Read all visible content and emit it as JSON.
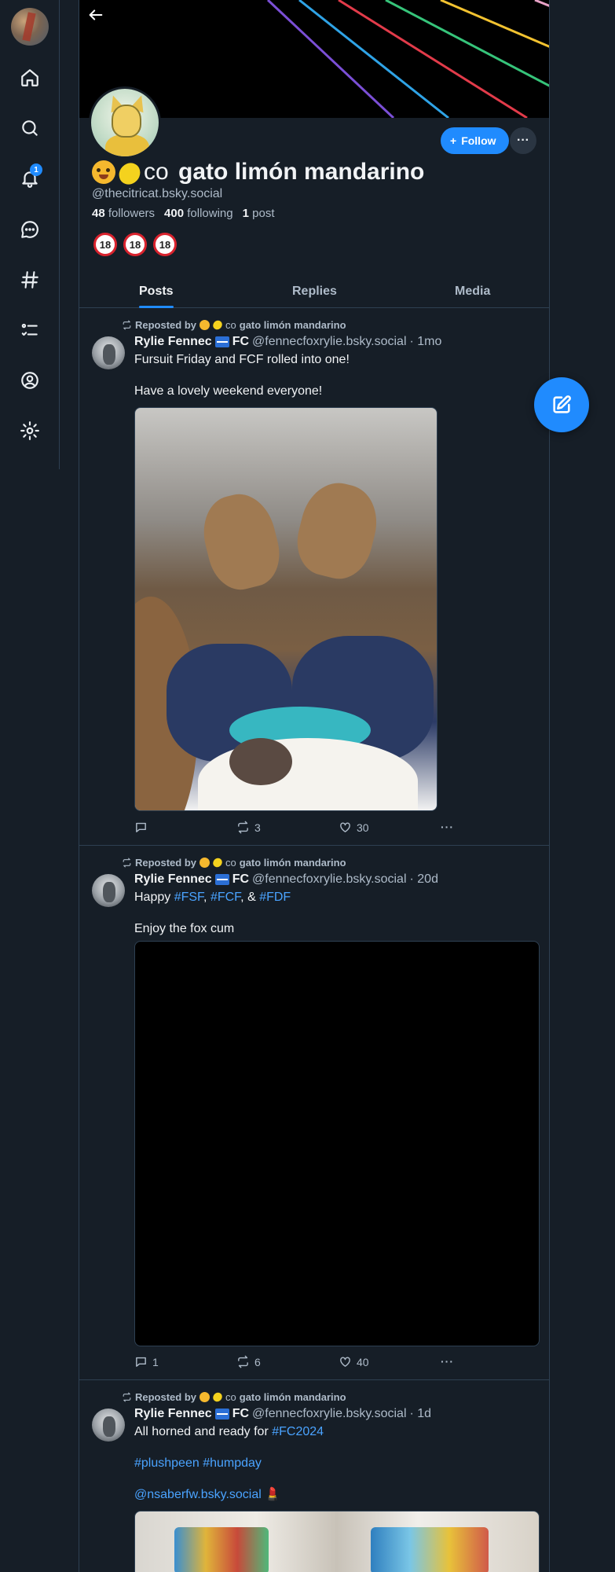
{
  "profile": {
    "name_prefix": "co",
    "name_main": "gato limón mandarino",
    "handle": "@thecitricat.bsky.social",
    "followers_count": "48",
    "followers_label": "followers",
    "following_count": "400",
    "following_label": "following",
    "posts_count": "1",
    "posts_label": "post",
    "content_labels": [
      "18",
      "18",
      "18"
    ],
    "follow_label": "Follow",
    "more_label": "···"
  },
  "nav": {
    "notification_count": "1",
    "items": [
      "home-icon",
      "search-icon",
      "bell-icon",
      "chat-icon",
      "hashtag-icon",
      "list-icon",
      "profile-icon",
      "settings-icon"
    ]
  },
  "tabs": [
    "Posts",
    "Replies",
    "Media"
  ],
  "posts": [
    {
      "repost_label": "Reposted by",
      "repost_name_prefix": "co",
      "repost_name_main": "gato limón mandarino",
      "author": "Rylie Fennec",
      "author_suffix": "FC",
      "handle": "@fennecfoxrylie.bsky.social",
      "time": "· 1mo",
      "line1": "Fursuit Friday and FCF rolled into one!",
      "line2": "Have a lovely weekend everyone!",
      "replies": "",
      "reposts": "3",
      "likes": "30"
    },
    {
      "repost_label": "Reposted by",
      "repost_name_prefix": "co",
      "repost_name_main": "gato limón mandarino",
      "author": "Rylie Fennec",
      "author_suffix": "FC",
      "handle": "@fennecfoxrylie.bsky.social",
      "time": "· 20d",
      "line1_a": "Happy ",
      "tag1": "#FSF",
      "sep1": ", ",
      "tag2": "#FCF",
      "sep2": ", & ",
      "tag3": "#FDF",
      "line2": "Enjoy the fox cum",
      "replies": "1",
      "reposts": "6",
      "likes": "40"
    },
    {
      "repost_label": "Reposted by",
      "repost_name_prefix": "co",
      "repost_name_main": "gato limón mandarino",
      "author": "Rylie Fennec",
      "author_suffix": "FC",
      "handle": "@fennecfoxrylie.bsky.social",
      "time": "· 1d",
      "line1_a": "All horned and ready for ",
      "tag1": "#FC2024",
      "line2_tag1": "#plushpeen",
      "line2_tag2": "#humpday",
      "line3_mention": "@nsaberfw.bsky.social",
      "line3_emoji": "💄"
    }
  ],
  "colors": {
    "background": "#161e27",
    "accent": "#208bfe",
    "border": "#2e4052",
    "muted_text": "#aebbc9",
    "link": "#4aa3ff"
  }
}
